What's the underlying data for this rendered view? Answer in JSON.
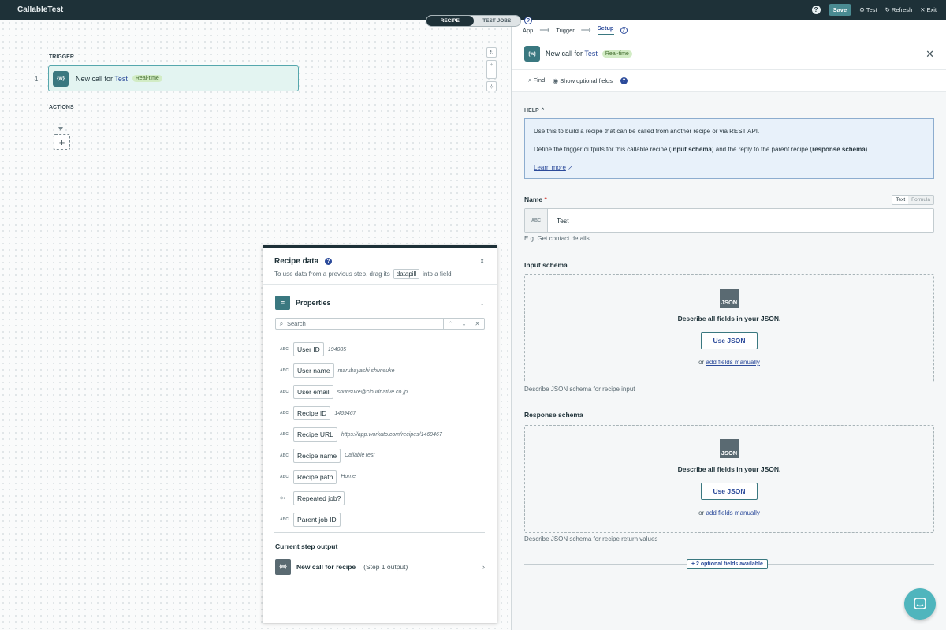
{
  "app_title": "CallableTest",
  "topbar": {
    "save_label": "Save",
    "test_label": "Test",
    "refresh_label": "Refresh",
    "exit_label": "Exit"
  },
  "view_toggle": {
    "recipe": "RECIPE",
    "test_jobs": "TEST JOBS"
  },
  "canvas": {
    "trigger_label": "TRIGGER",
    "actions_label": "ACTIONS",
    "step_number": "1",
    "trigger_prefix": "New call for",
    "trigger_name": "Test",
    "badge": "Real-time",
    "app_icon_text": "{w}"
  },
  "recipe_data": {
    "title": "Recipe data",
    "subtitle_before": "To use data from a previous step, drag its",
    "subtitle_pill": "datapill",
    "subtitle_after": "into a field",
    "properties_label": "Properties",
    "search_placeholder": "Search",
    "properties": [
      {
        "type": "ABC",
        "name": "User ID",
        "value": "194085"
      },
      {
        "type": "ABC",
        "name": "User name",
        "value": "marubayashi shunsuke"
      },
      {
        "type": "ABC",
        "name": "User email",
        "value": "shunsuke@cloudnative.co.jp"
      },
      {
        "type": "ABC",
        "name": "Recipe ID",
        "value": "1469467"
      },
      {
        "type": "ABC",
        "name": "Recipe URL",
        "value": "https://app.workato.com/recipes/1469467"
      },
      {
        "type": "ABC",
        "name": "Recipe name",
        "value": "CallableTest"
      },
      {
        "type": "ABC",
        "name": "Recipe path",
        "value": "Home"
      },
      {
        "type": "toggle",
        "name": "Repeated job?",
        "value": ""
      },
      {
        "type": "ABC",
        "name": "Parent job ID",
        "value": ""
      }
    ],
    "current_step_label": "Current step output",
    "current_step_name": "New call for recipe",
    "current_step_sub": "(Step 1 output)"
  },
  "setup": {
    "breadcrumb": [
      "App",
      "Trigger",
      "Setup"
    ],
    "step_prefix": "New call for",
    "step_name": "Test",
    "badge": "Real-time",
    "find_label": "Find",
    "show_optional_label": "Show optional fields",
    "help_label": "HELP",
    "help_line1": "Use this to build a recipe that can be called from another recipe or via REST API.",
    "help_line2_a": "Define the trigger outputs for this callable recipe (",
    "help_line2_b": "input schema",
    "help_line2_c": ") and the reply to the parent recipe (",
    "help_line2_d": "response schema",
    "help_line2_e": ").",
    "learn_more": "Learn more",
    "name_label": "Name",
    "name_required": "*",
    "toggle_text": "Text",
    "toggle_formula": "Formula",
    "name_type": "ABC",
    "name_value": "Test",
    "name_hint": "E.g. Get contact details",
    "input_schema_label": "Input schema",
    "input_schema_hint": "Describe JSON schema for recipe input",
    "response_schema_label": "Response schema",
    "response_schema_hint": "Describe JSON schema for recipe return values",
    "json_icon_text": "JSON",
    "describe_text": "Describe all fields in your JSON.",
    "use_json_label": "Use JSON",
    "or_text": "or",
    "add_fields_link": "add fields manually",
    "optional_fields_btn": "+ 2 optional fields available"
  }
}
